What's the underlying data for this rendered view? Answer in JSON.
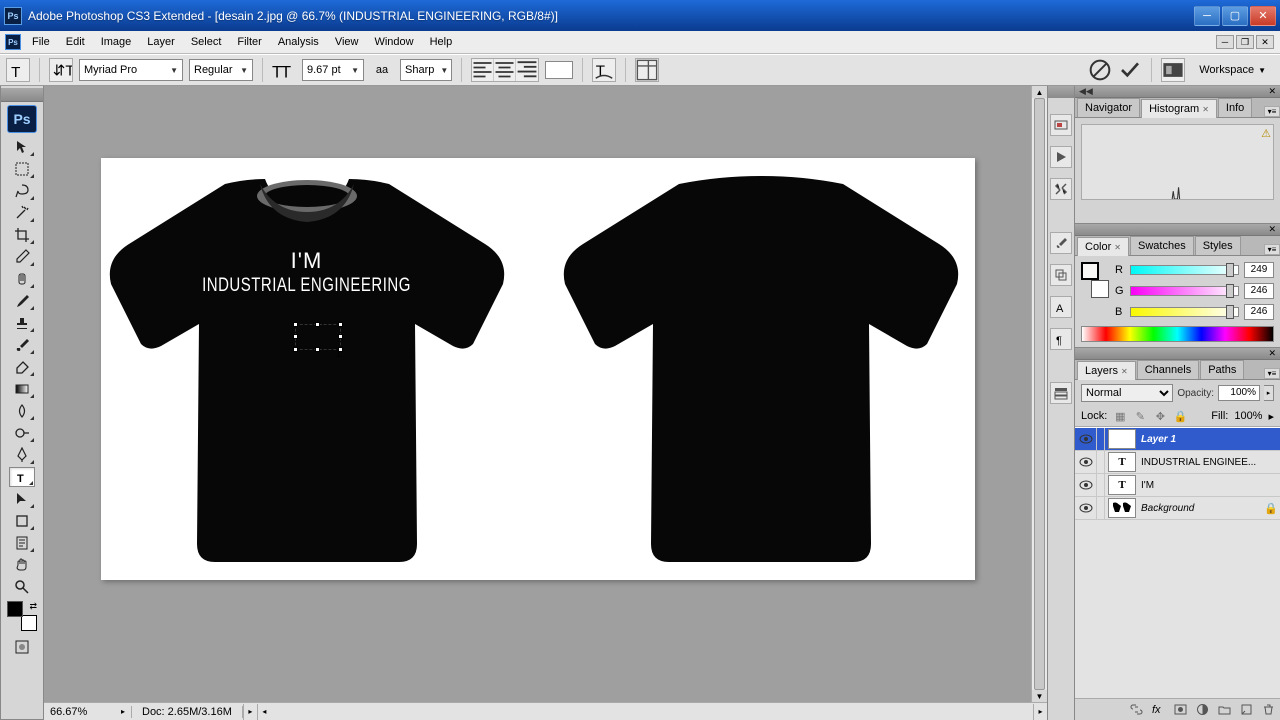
{
  "title": "Adobe Photoshop CS3 Extended - [desain 2.jpg @ 66.7% (INDUSTRIAL ENGINEERING, RGB/8#)]",
  "menu": [
    "File",
    "Edit",
    "Image",
    "Layer",
    "Select",
    "Filter",
    "Analysis",
    "View",
    "Window",
    "Help"
  ],
  "options": {
    "font": "Myriad Pro",
    "weight": "Regular",
    "size": "9.67 pt",
    "aa": "Sharp"
  },
  "workspace_label": "Workspace",
  "tabs": {
    "nav": [
      "Navigator",
      "Histogram",
      "Info"
    ],
    "color": [
      "Color",
      "Swatches",
      "Styles"
    ],
    "layers": [
      "Layers",
      "Channels",
      "Paths"
    ]
  },
  "color": {
    "r_label": "R",
    "r_val": "249",
    "g_label": "G",
    "g_val": "246",
    "b_label": "B",
    "b_val": "246"
  },
  "layers_panel": {
    "blend": "Normal",
    "opacity_label": "Opacity:",
    "opacity_val": "100%",
    "lock_label": "Lock:",
    "fill_label": "Fill:",
    "fill_val": "100%"
  },
  "layers": [
    {
      "name": "Layer 1",
      "type": "T"
    },
    {
      "name": "INDUSTRIAL ENGINEE...",
      "type": "T"
    },
    {
      "name": "I'M",
      "type": "T"
    },
    {
      "name": "Background",
      "type": "bg"
    }
  ],
  "canvas": {
    "text1": "I'M",
    "text2": "INDUSTRIAL ENGINEERING"
  },
  "status": {
    "zoom": "66.67%",
    "doc": "Doc: 2.65M/3.16M"
  }
}
